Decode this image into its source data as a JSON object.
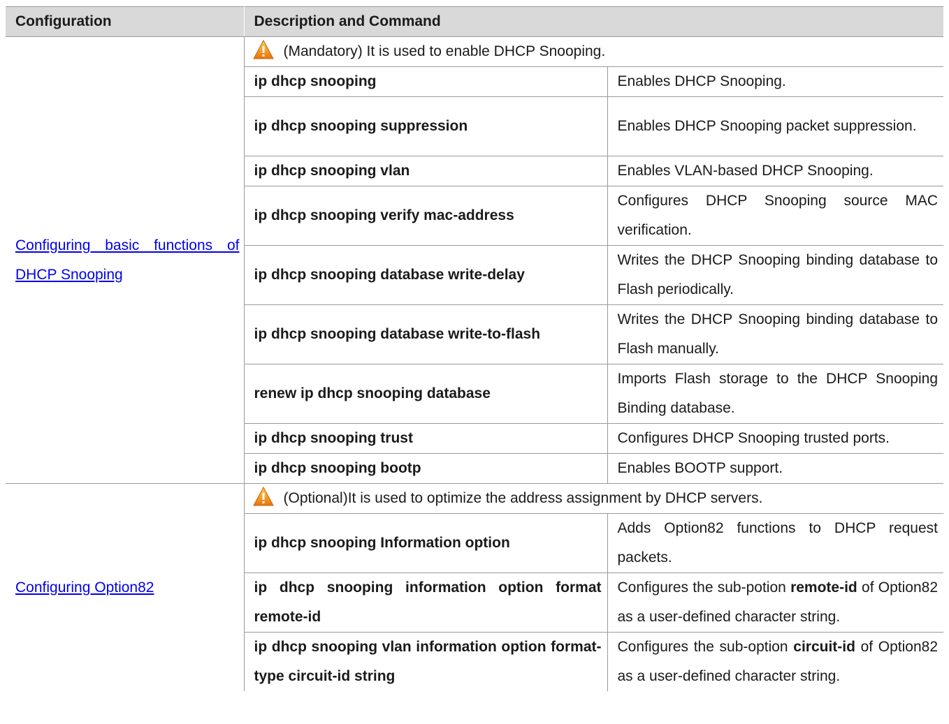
{
  "header": {
    "col1": "Configuration",
    "col2": "Description and Command"
  },
  "sections": [
    {
      "config_link": "Configuring basic functions of DHCP Snooping",
      "note": "(Mandatory) It is used to enable DHCP Snooping.",
      "rows": [
        {
          "cmd": "ip dhcp snooping",
          "desc": "Enables DHCP Snooping."
        },
        {
          "cmd": "ip dhcp snooping suppression",
          "desc": "Enables DHCP Snooping packet suppression."
        },
        {
          "cmd": "ip dhcp snooping vlan",
          "desc": "Enables VLAN-based DHCP Snooping."
        },
        {
          "cmd": "ip dhcp snooping verify mac-address",
          "desc": "Configures DHCP Snooping source MAC verification."
        },
        {
          "cmd": "ip dhcp snooping database write-delay",
          "desc": "Writes the DHCP Snooping binding database to Flash periodically."
        },
        {
          "cmd": "ip dhcp snooping database write-to-flash",
          "desc": "Writes the DHCP Snooping binding database to Flash manually."
        },
        {
          "cmd": "renew ip dhcp snooping database",
          "desc": "Imports Flash storage to the DHCP Snooping Binding database."
        },
        {
          "cmd": "ip dhcp snooping trust",
          "desc": "Configures DHCP Snooping trusted ports."
        },
        {
          "cmd": "ip dhcp snooping bootp",
          "desc": "Enables BOOTP support."
        }
      ]
    },
    {
      "config_link": "Configuring Option82",
      "note": "(Optional)It is used to optimize the address assignment by DHCP servers.",
      "rows": [
        {
          "cmd": "ip dhcp snooping Information option",
          "desc": "Adds Option82 functions to DHCP request packets."
        },
        {
          "cmd": "ip dhcp snooping information option format remote-id",
          "desc_a": "Configures the sub-potion ",
          "desc_b": "remote-id",
          "desc_c": " of Option82 as a user-defined character string."
        },
        {
          "cmd": "ip dhcp snooping vlan information option format-type circuit-id string",
          "desc_a": "Configures the sub-option ",
          "desc_b": "circuit-id",
          "desc_c": " of Option82 as a user-defined character string."
        }
      ]
    }
  ],
  "colors": {
    "header_bg": "#d9d9d9",
    "link": "#0000ee",
    "warning": "#f39c12"
  },
  "icons": {
    "note_icon": "warning-triangle-icon"
  }
}
